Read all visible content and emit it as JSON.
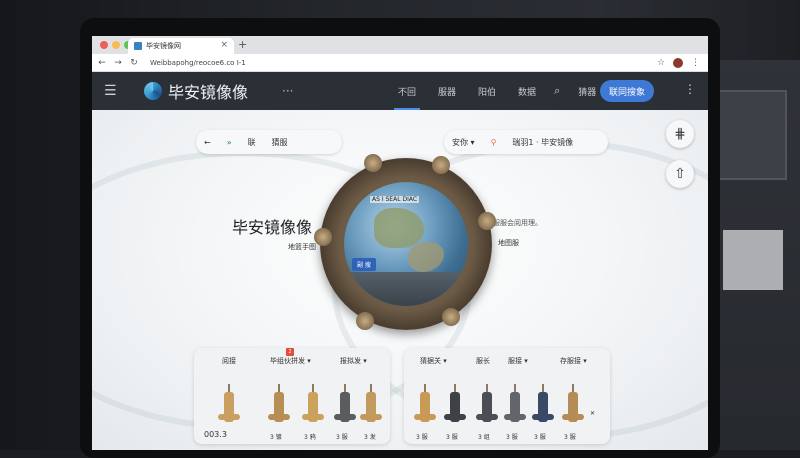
{
  "browser": {
    "tab_title": "毕安镜像网",
    "url": "Weibbapohg/reocoe6.co I-1",
    "traffic_colors": [
      "#ec5f57",
      "#f4be4f",
      "#5fc454"
    ]
  },
  "header": {
    "brand": "毕安镜像像",
    "more": "···",
    "nav": [
      "不回",
      "服器",
      "阳伯",
      "数据"
    ],
    "nav_right": [
      "猜器",
      "阳伯"
    ],
    "cta": "联同搜象",
    "accent": "#3f79d6"
  },
  "toolbar_left": {
    "back": "←",
    "arrow": "»",
    "item1": "联",
    "item2": "猜服"
  },
  "toolbar_right": {
    "filter": "安你 ▾",
    "location": "瑞羽1 · 毕安镜像"
  },
  "hero": {
    "title": "毕安镜像像",
    "desc": "服务又服服会阅用理。",
    "sub": "地篮手图",
    "sub2": "地图服",
    "globe_button": "副 搜",
    "globe_label": "AS I SEAL DIAC"
  },
  "card_left": {
    "labels": [
      "阅接",
      "毕组伙拼发 ▾",
      "报拟发 ▾"
    ],
    "badge": "2",
    "big": "003.3",
    "values": [
      "3 镀",
      "3 鸦",
      "3 服",
      "3 发"
    ]
  },
  "card_right": {
    "labels": [
      "猜据关 ▾",
      "服长",
      "服接 ▾",
      "存服接 ▾"
    ],
    "values": [
      "3 服",
      "3 服",
      "3 组",
      "3 服",
      "3 服",
      "3 服"
    ],
    "close": "✕"
  },
  "side_buttons": [
    "⋕",
    "⇧"
  ]
}
